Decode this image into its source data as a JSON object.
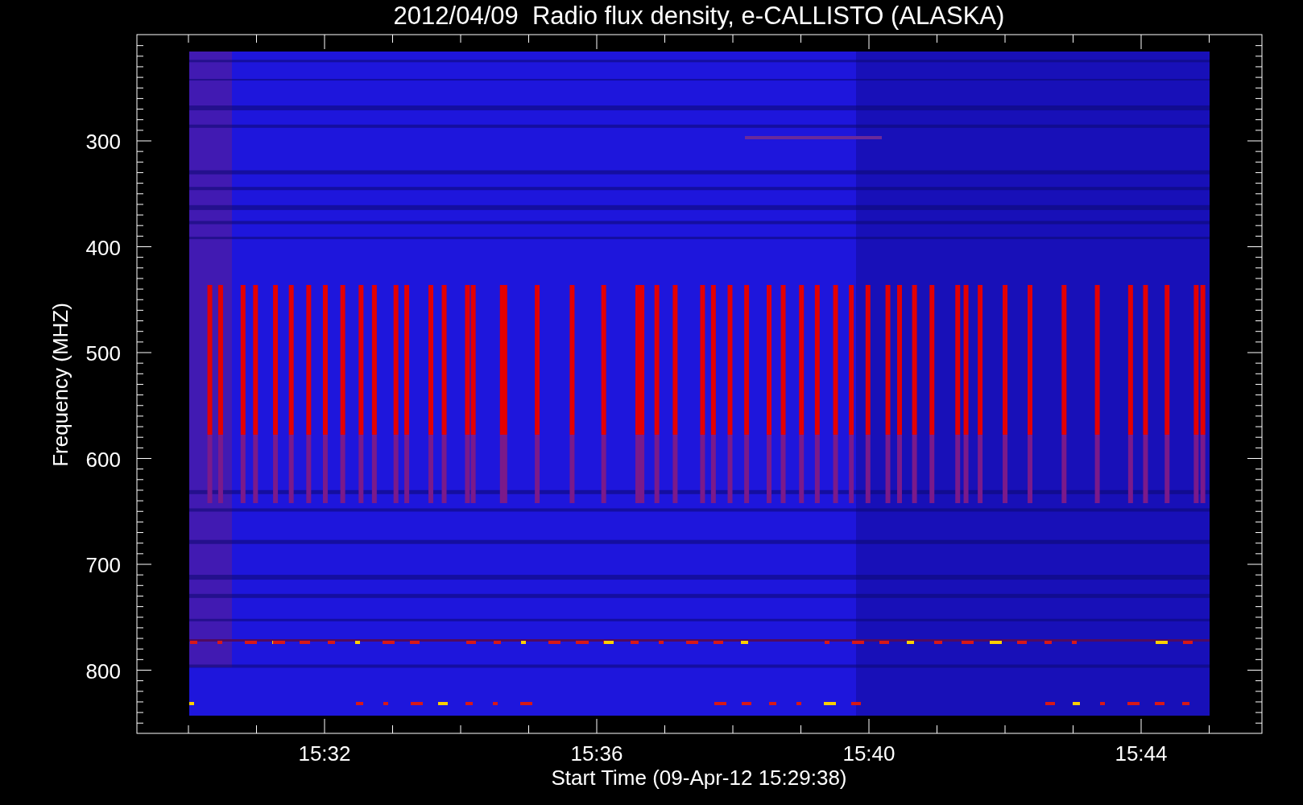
{
  "title": "2012/04/09  Radio flux density, e-CALLISTO (ALASKA)",
  "y_axis": {
    "label": "Frequency (MHZ)",
    "ticks": [
      "300",
      "400",
      "500",
      "600",
      "700",
      "800"
    ]
  },
  "x_axis": {
    "label": "Start Time (09-Apr-12 15:29:38)",
    "ticks": [
      "15:32",
      "15:36",
      "15:40",
      "15:44"
    ]
  }
}
